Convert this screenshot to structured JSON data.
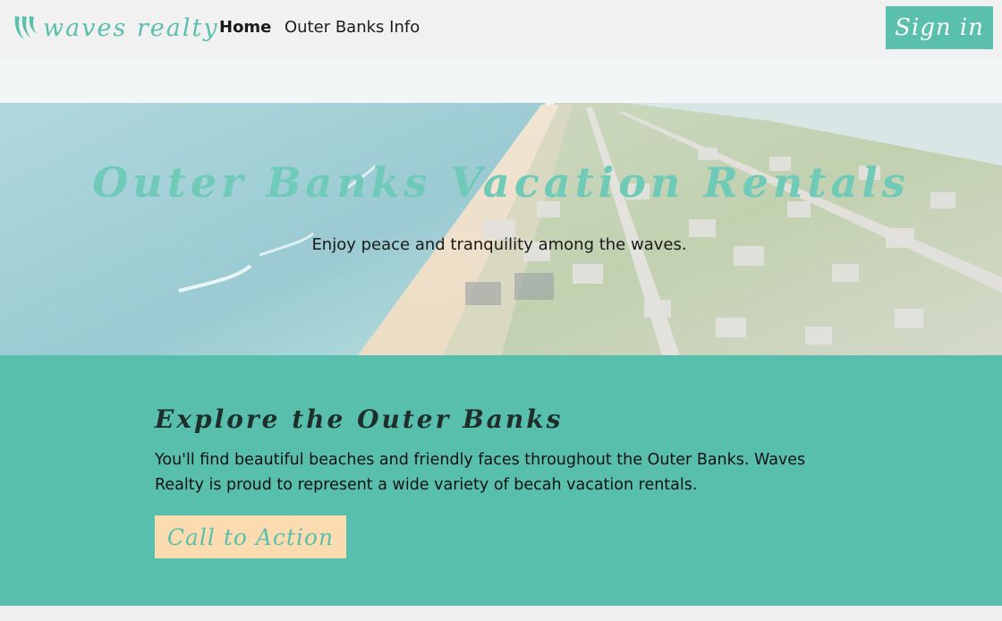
{
  "brand": {
    "name": "waves realty",
    "logo_icon": "waves-icon",
    "accent": "#5bbfad"
  },
  "nav": {
    "items": [
      {
        "label": "Home"
      },
      {
        "label": "Outer Banks Info"
      }
    ],
    "signin_label": "Sign in"
  },
  "hero": {
    "title": "Outer Banks Vacation Rentals",
    "subtitle": "Enjoy peace and tranquility among the waves."
  },
  "explore": {
    "title": "Explore the Outer Banks",
    "body": "You'll find beautiful beaches and friendly faces throughout the Outer Banks. Waves Realty is proud to represent a wide variety of becah vacation rentals.",
    "cta_label": "Call to Action",
    "background": "#59bfad",
    "cta_background": "#fbdcb0"
  }
}
